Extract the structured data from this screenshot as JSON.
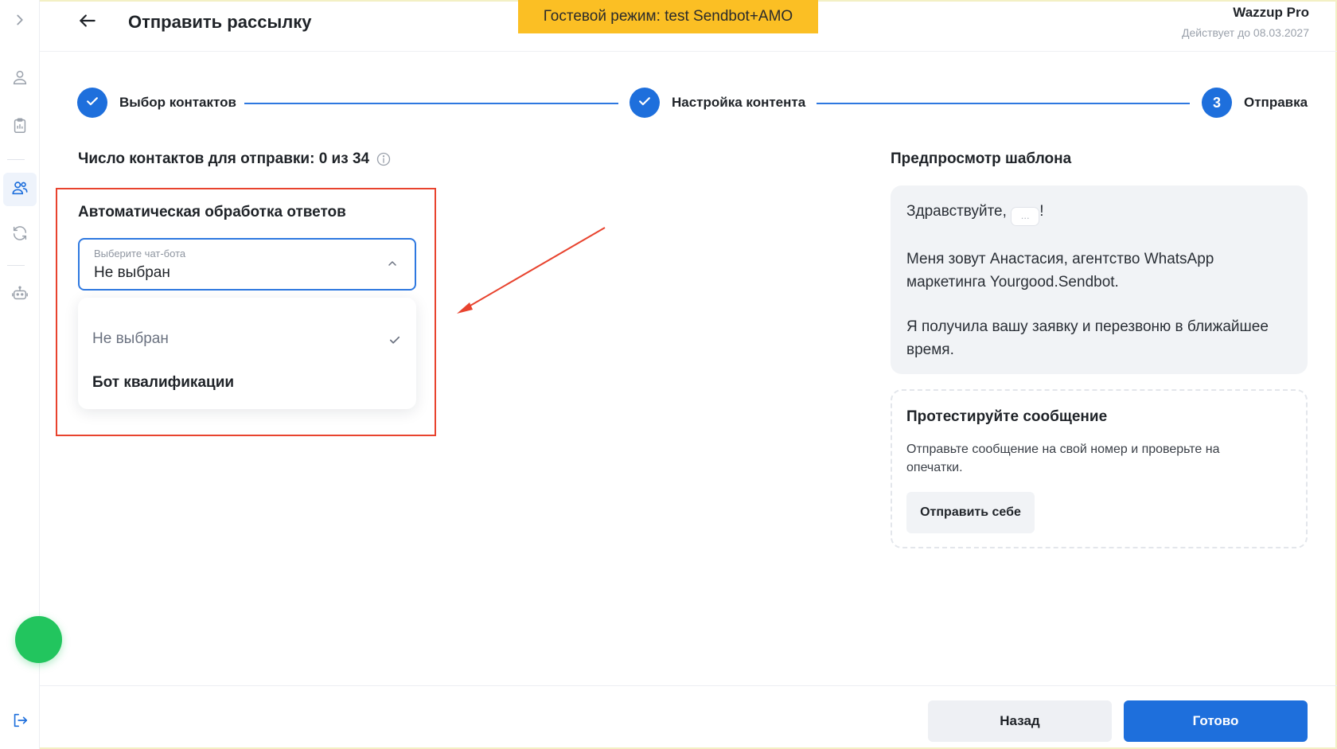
{
  "header": {
    "title": "Отправить рассылку",
    "guest_banner": "Гостевой режим: test Sendbot+AMO",
    "plan_name": "Wazzup Pro",
    "plan_valid": "Действует до 08.03.2027"
  },
  "stepper": {
    "steps": [
      {
        "label": "Выбор контактов",
        "state": "done"
      },
      {
        "label": "Настройка контента",
        "state": "done"
      },
      {
        "label": "Отправка",
        "number": "3",
        "state": "active"
      }
    ]
  },
  "contacts": {
    "count_label": "Число контактов для отправки: 0 из 34"
  },
  "auto_reply": {
    "title": "Автоматическая обработка ответов",
    "select_placeholder": "Выберите чат-бота",
    "select_value": "Не выбран",
    "options": [
      {
        "label": "Не выбран",
        "selected": true
      },
      {
        "label": "Бот квалификации",
        "selected": false
      }
    ]
  },
  "preview": {
    "title": "Предпросмотр шаблона",
    "greeting_before": "Здравствуйте, ",
    "greeting_var": "...",
    "greeting_after": "!",
    "paragraph_1": "Меня зовут Анастасия, агентство WhatsApp маркетинга Yourgood.Sendbot.",
    "paragraph_2": "Я получила вашу заявку и перезвоню в ближайшее время."
  },
  "test_message": {
    "title": "Протестируйте сообщение",
    "description": "Отправьте сообщение на свой номер и проверьте на опечатки.",
    "button_label": "Отправить себе"
  },
  "footer": {
    "back_label": "Назад",
    "done_label": "Готово"
  },
  "colors": {
    "primary": "#1e6fdc",
    "guest_banner": "#fbbf24",
    "highlight": "#e8432e",
    "status_green": "#22c55e"
  },
  "icons": {
    "sidebar": [
      "chevron-right-icon",
      "user-icon",
      "clipboard-icon",
      "contacts-icon",
      "refresh-icon",
      "robot-icon",
      "logout-icon"
    ],
    "header": [
      "arrow-left-icon"
    ]
  }
}
